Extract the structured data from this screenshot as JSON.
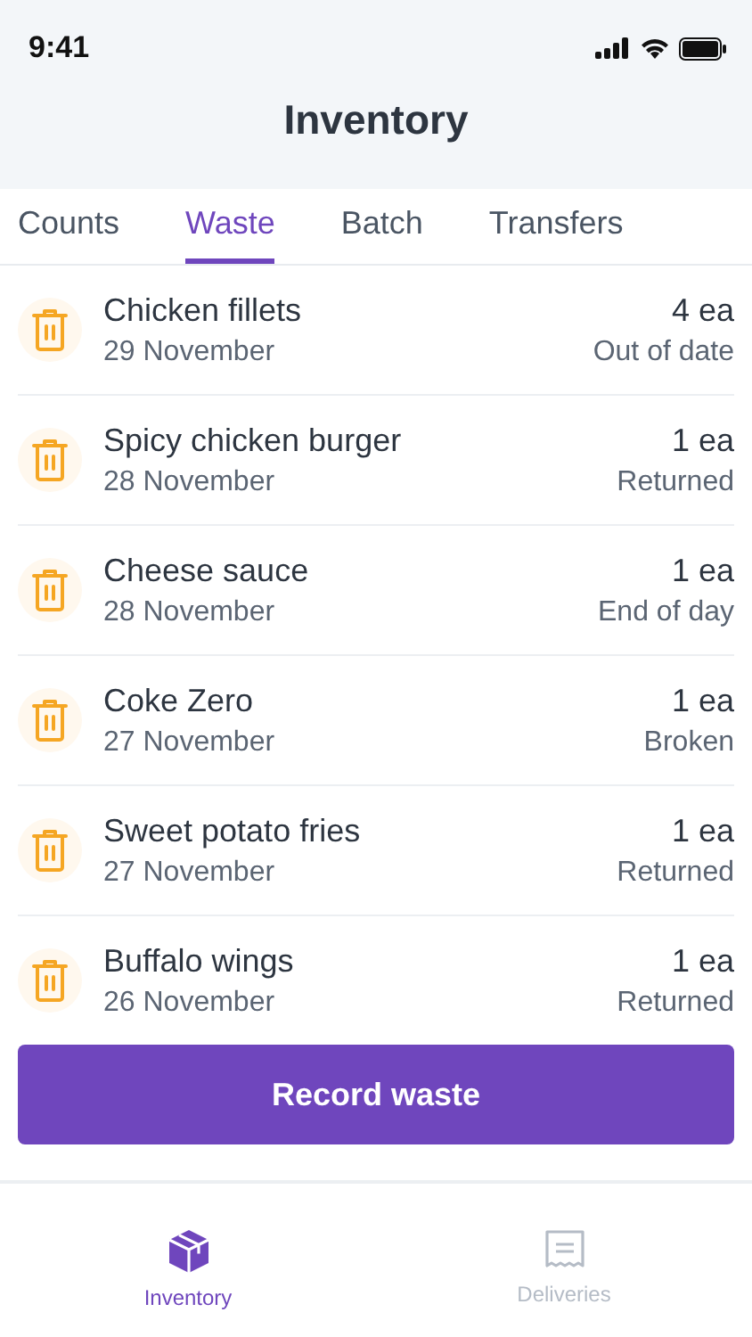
{
  "status_bar": {
    "time": "9:41"
  },
  "header": {
    "title": "Inventory"
  },
  "tabs": [
    {
      "label": "Counts",
      "selected": false
    },
    {
      "label": "Waste",
      "selected": true
    },
    {
      "label": "Batch",
      "selected": false
    },
    {
      "label": "Transfers",
      "selected": false
    }
  ],
  "items": [
    {
      "name": "Chicken fillets",
      "date": "29 November",
      "quantity": "4 ea",
      "reason": "Out of date"
    },
    {
      "name": "Spicy chicken burger",
      "date": "28 November",
      "quantity": "1 ea",
      "reason": "Returned"
    },
    {
      "name": "Cheese sauce",
      "date": "28 November",
      "quantity": "1 ea",
      "reason": "End of day"
    },
    {
      "name": "Coke Zero",
      "date": "27 November",
      "quantity": "1 ea",
      "reason": "Broken"
    },
    {
      "name": "Sweet potato fries",
      "date": "27 November",
      "quantity": "1 ea",
      "reason": "Returned"
    },
    {
      "name": "Buffalo wings",
      "date": "26 November",
      "quantity": "1 ea",
      "reason": "Returned"
    }
  ],
  "primary_button": "Record waste",
  "bottom_nav": [
    {
      "label": "Inventory",
      "kind": "box",
      "selected": true
    },
    {
      "label": "Deliveries",
      "kind": "receipt",
      "selected": false
    }
  ]
}
